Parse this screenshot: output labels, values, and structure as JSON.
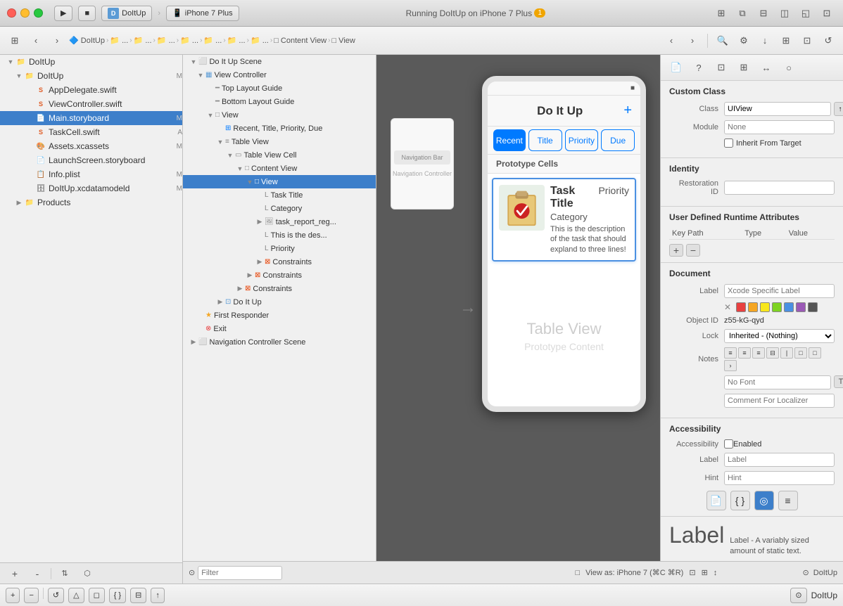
{
  "titlebar": {
    "app_name": "DoItUp",
    "device": "iPhone 7 Plus",
    "status": "Running DoItUp on iPhone 7 Plus",
    "warning_count": "1",
    "traffic_lights": [
      "red",
      "yellow",
      "green"
    ]
  },
  "breadcrumb": {
    "items": [
      "DoItUp",
      "...",
      "...",
      "...",
      "...",
      "...",
      "...",
      "...",
      "...",
      "...",
      "Content View",
      "View"
    ]
  },
  "file_tree": {
    "root": "DoItUp",
    "groups": [
      {
        "name": "DoItUp",
        "type": "group",
        "badge": "M",
        "children": [
          {
            "name": "AppDelegate.swift",
            "type": "swift",
            "badge": ""
          },
          {
            "name": "ViewController.swift",
            "type": "swift",
            "badge": ""
          },
          {
            "name": "Main.storyboard",
            "type": "storyboard",
            "badge": "M",
            "selected": true
          },
          {
            "name": "TaskCell.swift",
            "type": "swift",
            "badge": "A"
          },
          {
            "name": "Assets.xcassets",
            "type": "assets",
            "badge": "M"
          },
          {
            "name": "LaunchScreen.storyboard",
            "type": "storyboard",
            "badge": ""
          },
          {
            "name": "Info.plist",
            "type": "plist",
            "badge": "M"
          },
          {
            "name": "DoItUp.xcdatamodeld",
            "type": "data",
            "badge": "M"
          }
        ]
      },
      {
        "name": "Products",
        "type": "group",
        "children": []
      }
    ]
  },
  "outline": {
    "items": [
      {
        "name": "Do It Up Scene",
        "indent": 0,
        "arrow": "open",
        "icon": "scene"
      },
      {
        "name": "View Controller",
        "indent": 1,
        "arrow": "open",
        "icon": "viewcontroller"
      },
      {
        "name": "Top Layout Guide",
        "indent": 2,
        "arrow": "none",
        "icon": "layout"
      },
      {
        "name": "Bottom Layout Guide",
        "indent": 2,
        "arrow": "none",
        "icon": "layout"
      },
      {
        "name": "View",
        "indent": 2,
        "arrow": "open",
        "icon": "view"
      },
      {
        "name": "Recent, Title, Priority, Due",
        "indent": 3,
        "arrow": "none",
        "icon": "segcontrol"
      },
      {
        "name": "Table View",
        "indent": 3,
        "arrow": "open",
        "icon": "tableview"
      },
      {
        "name": "Table View Cell",
        "indent": 4,
        "arrow": "open",
        "icon": "cell"
      },
      {
        "name": "Content View",
        "indent": 5,
        "arrow": "open",
        "icon": "contentview"
      },
      {
        "name": "View",
        "indent": 6,
        "arrow": "open",
        "icon": "view",
        "selected": true
      },
      {
        "name": "Task Title",
        "indent": 7,
        "arrow": "none",
        "icon": "label"
      },
      {
        "name": "Category",
        "indent": 7,
        "arrow": "none",
        "icon": "label"
      },
      {
        "name": "task_report_reg...",
        "indent": 7,
        "arrow": "closed",
        "icon": "imageview"
      },
      {
        "name": "This is the des...",
        "indent": 7,
        "arrow": "none",
        "icon": "label"
      },
      {
        "name": "Priority",
        "indent": 7,
        "arrow": "none",
        "icon": "label"
      },
      {
        "name": "Constraints",
        "indent": 7,
        "arrow": "closed",
        "icon": "constraints"
      },
      {
        "name": "Constraints",
        "indent": 6,
        "arrow": "closed",
        "icon": "constraints"
      },
      {
        "name": "Constraints",
        "indent": 5,
        "arrow": "closed",
        "icon": "constraints"
      },
      {
        "name": "Do It Up",
        "indent": 3,
        "arrow": "closed",
        "icon": "baritem"
      },
      {
        "name": "First Responder",
        "indent": 1,
        "arrow": "none",
        "icon": "firstresponder"
      },
      {
        "name": "Exit",
        "indent": 1,
        "arrow": "none",
        "icon": "exit"
      },
      {
        "name": "Navigation Controller Scene",
        "indent": 0,
        "arrow": "closed",
        "icon": "scene"
      }
    ]
  },
  "iphone_mock": {
    "nav_title": "Do It Up",
    "add_btn": "+",
    "segments": [
      "Recent",
      "Title",
      "Priority",
      "Due"
    ],
    "active_segment": 0,
    "prototype_label": "Prototype Cells",
    "cell": {
      "title": "Task Title",
      "priority": "Priority",
      "category": "Category",
      "description": "This is the description of the task that should expland to three lines!"
    },
    "tableview_title": "Table View",
    "tableview_subtitle": "Prototype Content"
  },
  "inspector": {
    "custom_class": {
      "title": "Custom Class",
      "class_label": "Class",
      "class_value": "UIView",
      "module_label": "Module",
      "module_value": "None",
      "inherit_label": "Inherit From Target"
    },
    "identity": {
      "title": "Identity",
      "restoration_label": "Restoration ID",
      "restoration_value": ""
    },
    "user_defined": {
      "title": "User Defined Runtime Attributes",
      "columns": [
        "Key Path",
        "Type",
        "Value"
      ],
      "rows": []
    },
    "document": {
      "title": "Document",
      "label_label": "Label",
      "label_placeholder": "Xcode Specific Label",
      "object_id_label": "Object ID",
      "object_id_value": "z55-kG-qyd",
      "lock_label": "Lock",
      "lock_value": "Inherited - (Nothing)",
      "notes_label": "Notes",
      "font_placeholder": "No Font",
      "comment_placeholder": "Comment For Localizer"
    },
    "accessibility": {
      "title": "Accessibility",
      "accessibility_label": "Accessibility",
      "enabled_label": "Enabled",
      "label_label": "Label",
      "label_placeholder": "Label",
      "hint_label": "Hint",
      "hint_placeholder": "Hint"
    },
    "bottom_icons": [
      "doc",
      "code",
      "circle-filled",
      "list"
    ],
    "label_section": {
      "big_label": "Label",
      "description": "Label - A variably sized amount of static text."
    }
  },
  "storyboard_bottom": {
    "filter_placeholder": "Filter",
    "view_as": "View as: iPhone 7 (⌘C ⌘R)",
    "app_label": "DoItUp"
  },
  "bottom_bar": {
    "plus_tooltip": "Add",
    "minus_tooltip": "Remove"
  }
}
